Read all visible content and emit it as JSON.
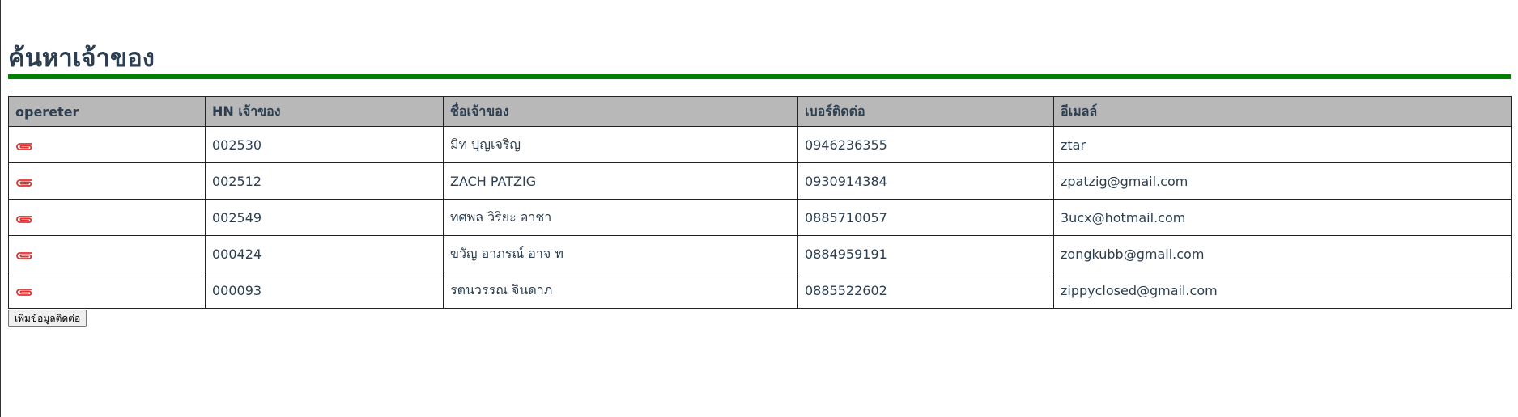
{
  "page": {
    "title": "ค้นหาเจ้าของ",
    "rule_color": "#008000"
  },
  "table": {
    "headers": [
      "opereter",
      "HN เจ้าของ",
      "ชื่อเจ้าของ",
      "เบอร์ติดต่อ",
      "อีเมลล์"
    ],
    "action_icon": "paperclip-icon",
    "icon_color": "#e03030",
    "rows": [
      {
        "hn": "002530",
        "name": "มิท บุญเจริญ",
        "phone": "0946236355",
        "email": "ztar"
      },
      {
        "hn": "002512",
        "name": "ZACH PATZIG",
        "phone": "0930914384",
        "email": "zpatzig@gmail.com"
      },
      {
        "hn": "002549",
        "name": "ทศพล วิริยะ อาชา",
        "phone": "0885710057",
        "email": "3ucx@hotmail.com"
      },
      {
        "hn": "000424",
        "name": "ขวัญ อาภรณ์ อาจ ท",
        "phone": "0884959191",
        "email": "zongkubb@gmail.com"
      },
      {
        "hn": "000093",
        "name": "รตนวรรณ จินดาภ",
        "phone": "0885522602",
        "email": "zippyclosed@gmail.com"
      }
    ]
  },
  "actions": {
    "add_contact_label": "เพิ่มข้อมูลติดต่อ"
  }
}
